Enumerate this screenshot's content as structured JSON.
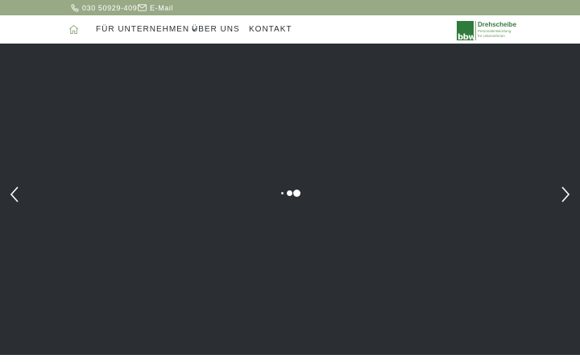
{
  "topbar": {
    "phone": {
      "label": "030 50929-409",
      "icon": "phone-icon"
    },
    "email": {
      "label": "E-Mail",
      "icon": "mail-icon"
    },
    "background_color": "#98a985"
  },
  "nav": {
    "home_icon": "home-icon",
    "items": [
      {
        "label": "FÜR UNTERNEHMEN",
        "has_dropdown": true
      },
      {
        "label": "ÜBER UNS",
        "has_dropdown": false
      },
      {
        "label": "KONTAKT",
        "has_dropdown": false
      }
    ]
  },
  "logo": {
    "mark": "bbw",
    "name": "Drehscheibe",
    "tagline_1": "Personalentwicklung",
    "tagline_2": "für Unternehmen",
    "color": "#2f7b3b"
  },
  "slider": {
    "background_color": "#2b2f33",
    "prev_icon": "chevron-left-icon",
    "next_icon": "chevron-right-icon",
    "loader_icon": "loading-dots-icon"
  }
}
